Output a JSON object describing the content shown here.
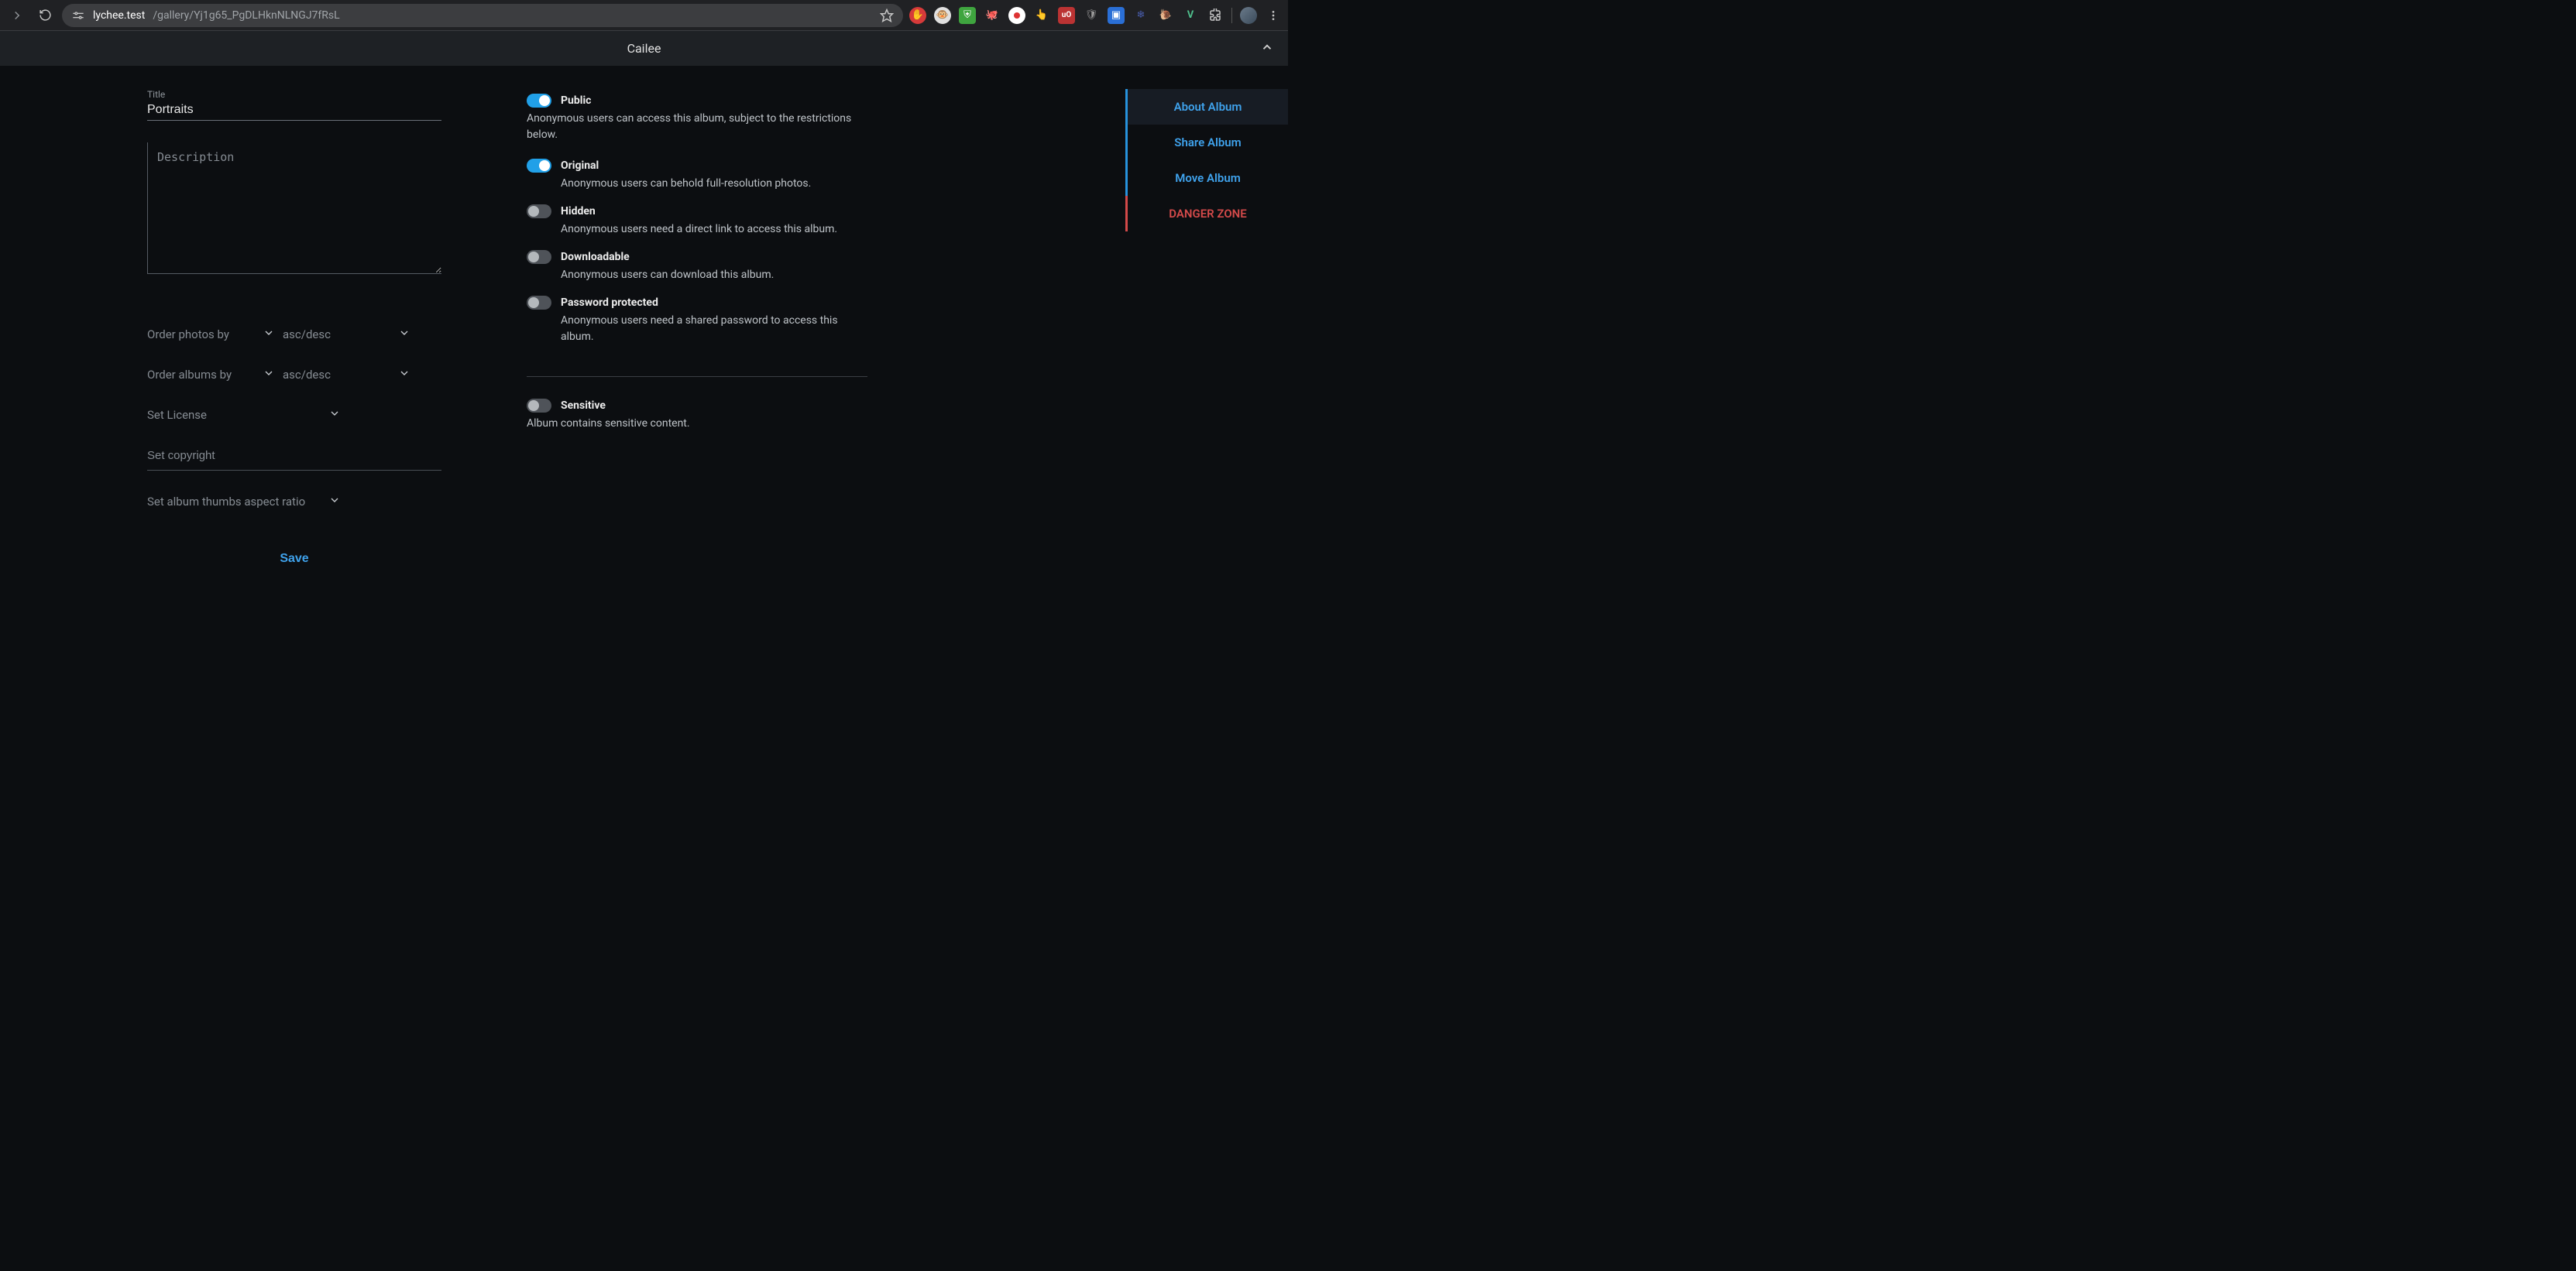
{
  "browser": {
    "url_host": "lychee.test",
    "url_path": "/gallery/Yj1g65_PgDLHknNLNGJ7fRsL"
  },
  "header": {
    "title": "Cailee"
  },
  "form": {
    "title_label": "Title",
    "title_value": "Portraits",
    "description_placeholder": "Description",
    "order_photos_label": "Order photos by",
    "order_albums_label": "Order albums by",
    "order_dir_placeholder": "asc/desc",
    "license_placeholder": "Set License",
    "copyright_placeholder": "Set copyright",
    "aspect_placeholder": "Set album thumbs aspect ratio",
    "save_label": "Save"
  },
  "toggles": {
    "public": {
      "label": "Public",
      "desc": "Anonymous users can access this album, subject to the restrictions below.",
      "on": true
    },
    "original": {
      "label": "Original",
      "desc": "Anonymous users can behold full-resolution photos.",
      "on": true
    },
    "hidden": {
      "label": "Hidden",
      "desc": "Anonymous users need a direct link to access this album.",
      "on": false
    },
    "downloadable": {
      "label": "Downloadable",
      "desc": "Anonymous users can download this album.",
      "on": false
    },
    "password": {
      "label": "Password protected",
      "desc": "Anonymous users need a shared password to access this album.",
      "on": false
    },
    "sensitive": {
      "label": "Sensitive",
      "desc": "Album contains sensitive content.",
      "on": false
    }
  },
  "side": {
    "about": "About Album",
    "share": "Share Album",
    "move": "Move Album",
    "danger": "DANGER ZONE"
  }
}
